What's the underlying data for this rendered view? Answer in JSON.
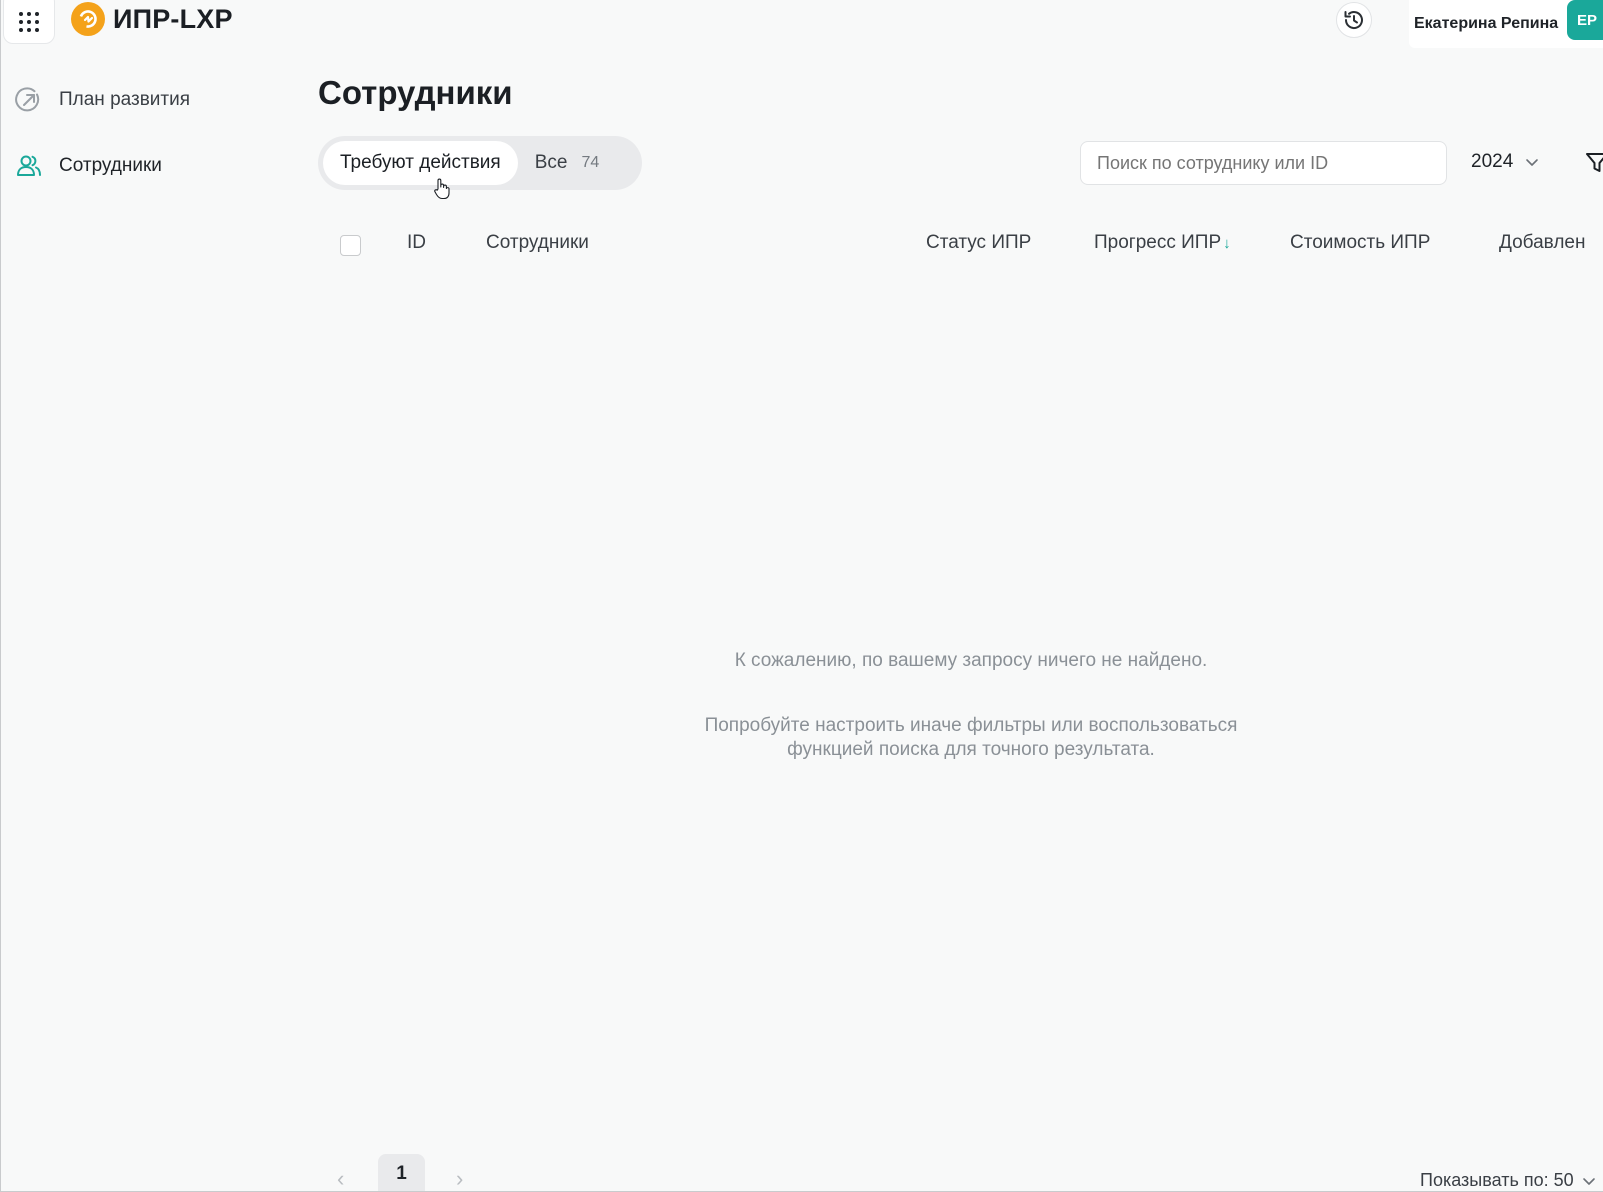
{
  "header": {
    "app_title": "ИПР-LXP",
    "user_name": "Екатерина Репина",
    "avatar_initials": "ЕР"
  },
  "sidebar": {
    "items": [
      {
        "label": "План развития",
        "icon": "arrow-up-right-circle-icon",
        "active": false
      },
      {
        "label": "Сотрудники",
        "icon": "users-icon",
        "active": true
      }
    ]
  },
  "main": {
    "title": "Сотрудники",
    "tabs": [
      {
        "label": "Требуют действия",
        "active": true
      },
      {
        "label": "Все",
        "count": "74",
        "active": false
      }
    ],
    "search_placeholder": "Поиск по сотруднику или ID",
    "year": "2024",
    "columns": [
      "ID",
      "Сотрудники",
      "Статус ИПР",
      "Прогресс ИПР",
      "Стоимость ИПР",
      "Добавлен"
    ],
    "sorted_column": "Прогресс ИПР",
    "sort_direction": "desc",
    "empty_title": "К сожалению, по вашему запросу ничего не найдено.",
    "empty_hint_line1": "Попробуйте настроить иначе фильтры или воспользоваться",
    "empty_hint_line2": "функцией поиска для точного результата."
  },
  "pagination": {
    "current_page": "1",
    "per_page_label": "Показывать по: 50"
  },
  "colors": {
    "accent": "#1aa89a",
    "logo": "#f4a21a",
    "background": "#f8f9f9"
  }
}
